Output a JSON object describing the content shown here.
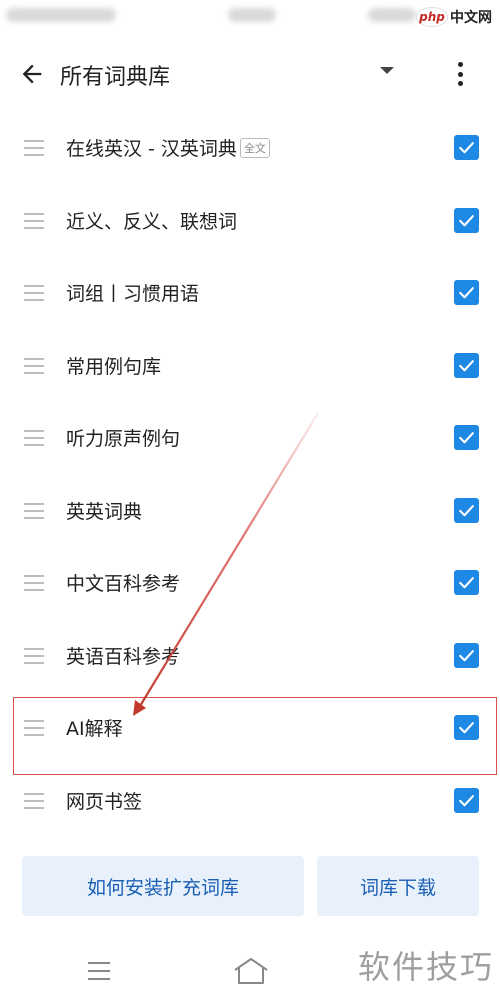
{
  "header": {
    "title": "所有词典库"
  },
  "branding": {
    "php_mark": "php",
    "site_name": "中文网",
    "watermark": "软件技巧"
  },
  "dictionaries": [
    {
      "label": "在线英汉 - 汉英词典",
      "tag": "全文",
      "checked": true
    },
    {
      "label": "近义、反义、联想词",
      "tag": "",
      "checked": true
    },
    {
      "label": "词组丨习惯用语",
      "tag": "",
      "checked": true
    },
    {
      "label": "常用例句库",
      "tag": "",
      "checked": true
    },
    {
      "label": "听力原声例句",
      "tag": "",
      "checked": true
    },
    {
      "label": "英英词典",
      "tag": "",
      "checked": true
    },
    {
      "label": "中文百科参考",
      "tag": "",
      "checked": true
    },
    {
      "label": "英语百科参考",
      "tag": "",
      "checked": true
    },
    {
      "label": "AI解释",
      "tag": "",
      "checked": true
    },
    {
      "label": "网页书签",
      "tag": "",
      "checked": true
    }
  ],
  "buttons": {
    "install_label": "如何安装扩充词库",
    "download_label": "词库下载"
  },
  "colors": {
    "accent": "#1e88e5",
    "button_bg": "#e8f1fb",
    "button_text": "#1a5fb4",
    "annotation": "#d9534f"
  },
  "icons": {
    "back": "arrow-left-icon",
    "dropdown": "triangle-down-icon",
    "more": "more-vertical-icon",
    "drag": "drag-handle-icon",
    "check": "checkbox-checked-icon",
    "menu": "menu-icon",
    "home": "home-icon"
  }
}
